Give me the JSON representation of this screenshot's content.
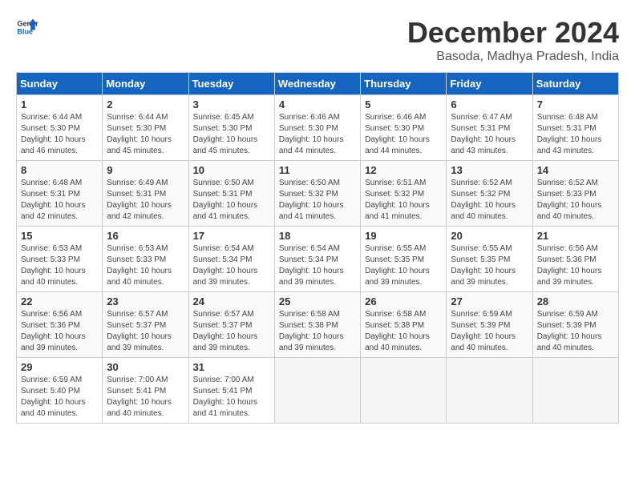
{
  "logo": {
    "text_general": "General",
    "text_blue": "Blue"
  },
  "title": {
    "month_year": "December 2024",
    "location": "Basoda, Madhya Pradesh, India"
  },
  "headers": [
    "Sunday",
    "Monday",
    "Tuesday",
    "Wednesday",
    "Thursday",
    "Friday",
    "Saturday"
  ],
  "weeks": [
    [
      {
        "day": "1",
        "info": "Sunrise: 6:44 AM\nSunset: 5:30 PM\nDaylight: 10 hours\nand 46 minutes."
      },
      {
        "day": "2",
        "info": "Sunrise: 6:44 AM\nSunset: 5:30 PM\nDaylight: 10 hours\nand 45 minutes."
      },
      {
        "day": "3",
        "info": "Sunrise: 6:45 AM\nSunset: 5:30 PM\nDaylight: 10 hours\nand 45 minutes."
      },
      {
        "day": "4",
        "info": "Sunrise: 6:46 AM\nSunset: 5:30 PM\nDaylight: 10 hours\nand 44 minutes."
      },
      {
        "day": "5",
        "info": "Sunrise: 6:46 AM\nSunset: 5:30 PM\nDaylight: 10 hours\nand 44 minutes."
      },
      {
        "day": "6",
        "info": "Sunrise: 6:47 AM\nSunset: 5:31 PM\nDaylight: 10 hours\nand 43 minutes."
      },
      {
        "day": "7",
        "info": "Sunrise: 6:48 AM\nSunset: 5:31 PM\nDaylight: 10 hours\nand 43 minutes."
      }
    ],
    [
      {
        "day": "8",
        "info": "Sunrise: 6:48 AM\nSunset: 5:31 PM\nDaylight: 10 hours\nand 42 minutes."
      },
      {
        "day": "9",
        "info": "Sunrise: 6:49 AM\nSunset: 5:31 PM\nDaylight: 10 hours\nand 42 minutes."
      },
      {
        "day": "10",
        "info": "Sunrise: 6:50 AM\nSunset: 5:31 PM\nDaylight: 10 hours\nand 41 minutes."
      },
      {
        "day": "11",
        "info": "Sunrise: 6:50 AM\nSunset: 5:32 PM\nDaylight: 10 hours\nand 41 minutes."
      },
      {
        "day": "12",
        "info": "Sunrise: 6:51 AM\nSunset: 5:32 PM\nDaylight: 10 hours\nand 41 minutes."
      },
      {
        "day": "13",
        "info": "Sunrise: 6:52 AM\nSunset: 5:32 PM\nDaylight: 10 hours\nand 40 minutes."
      },
      {
        "day": "14",
        "info": "Sunrise: 6:52 AM\nSunset: 5:33 PM\nDaylight: 10 hours\nand 40 minutes."
      }
    ],
    [
      {
        "day": "15",
        "info": "Sunrise: 6:53 AM\nSunset: 5:33 PM\nDaylight: 10 hours\nand 40 minutes."
      },
      {
        "day": "16",
        "info": "Sunrise: 6:53 AM\nSunset: 5:33 PM\nDaylight: 10 hours\nand 40 minutes."
      },
      {
        "day": "17",
        "info": "Sunrise: 6:54 AM\nSunset: 5:34 PM\nDaylight: 10 hours\nand 39 minutes."
      },
      {
        "day": "18",
        "info": "Sunrise: 6:54 AM\nSunset: 5:34 PM\nDaylight: 10 hours\nand 39 minutes."
      },
      {
        "day": "19",
        "info": "Sunrise: 6:55 AM\nSunset: 5:35 PM\nDaylight: 10 hours\nand 39 minutes."
      },
      {
        "day": "20",
        "info": "Sunrise: 6:55 AM\nSunset: 5:35 PM\nDaylight: 10 hours\nand 39 minutes."
      },
      {
        "day": "21",
        "info": "Sunrise: 6:56 AM\nSunset: 5:36 PM\nDaylight: 10 hours\nand 39 minutes."
      }
    ],
    [
      {
        "day": "22",
        "info": "Sunrise: 6:56 AM\nSunset: 5:36 PM\nDaylight: 10 hours\nand 39 minutes."
      },
      {
        "day": "23",
        "info": "Sunrise: 6:57 AM\nSunset: 5:37 PM\nDaylight: 10 hours\nand 39 minutes."
      },
      {
        "day": "24",
        "info": "Sunrise: 6:57 AM\nSunset: 5:37 PM\nDaylight: 10 hours\nand 39 minutes."
      },
      {
        "day": "25",
        "info": "Sunrise: 6:58 AM\nSunset: 5:38 PM\nDaylight: 10 hours\nand 39 minutes."
      },
      {
        "day": "26",
        "info": "Sunrise: 6:58 AM\nSunset: 5:38 PM\nDaylight: 10 hours\nand 40 minutes."
      },
      {
        "day": "27",
        "info": "Sunrise: 6:59 AM\nSunset: 5:39 PM\nDaylight: 10 hours\nand 40 minutes."
      },
      {
        "day": "28",
        "info": "Sunrise: 6:59 AM\nSunset: 5:39 PM\nDaylight: 10 hours\nand 40 minutes."
      }
    ],
    [
      {
        "day": "29",
        "info": "Sunrise: 6:59 AM\nSunset: 5:40 PM\nDaylight: 10 hours\nand 40 minutes."
      },
      {
        "day": "30",
        "info": "Sunrise: 7:00 AM\nSunset: 5:41 PM\nDaylight: 10 hours\nand 40 minutes."
      },
      {
        "day": "31",
        "info": "Sunrise: 7:00 AM\nSunset: 5:41 PM\nDaylight: 10 hours\nand 41 minutes."
      },
      {
        "day": "",
        "info": ""
      },
      {
        "day": "",
        "info": ""
      },
      {
        "day": "",
        "info": ""
      },
      {
        "day": "",
        "info": ""
      }
    ]
  ]
}
